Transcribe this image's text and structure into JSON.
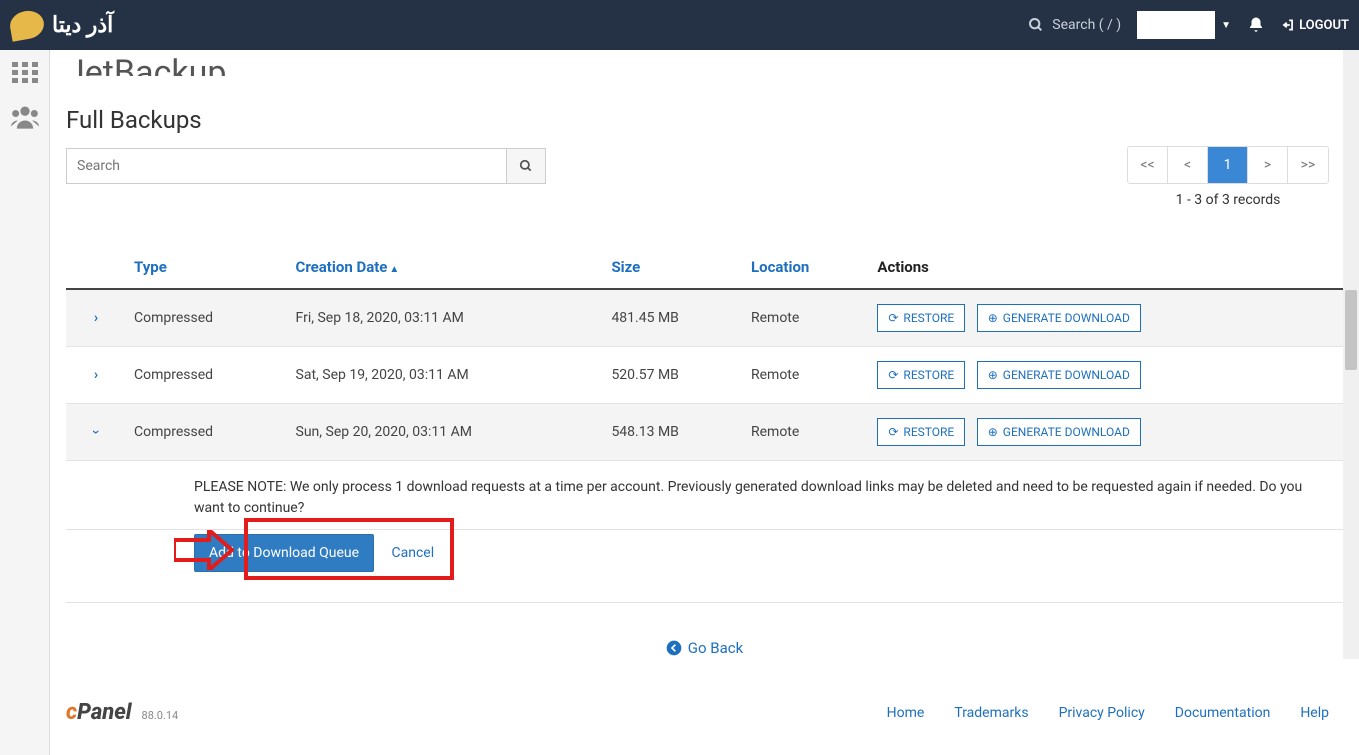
{
  "topbar": {
    "logo_text": "آذر دیتا",
    "search_label": "Search ( / )",
    "logout": "LOGOUT"
  },
  "page": {
    "app_title": "JetBackup",
    "section_title": "Full Backups",
    "search_placeholder": "Search"
  },
  "pager": {
    "first": "<<",
    "prev": "<",
    "current": "1",
    "next": ">",
    "last": ">>",
    "info": "1 - 3 of 3 records"
  },
  "columns": {
    "type": "Type",
    "creation": "Creation Date",
    "size": "Size",
    "location": "Location",
    "actions": "Actions"
  },
  "action_labels": {
    "restore": "RESTORE",
    "download": "GENERATE DOWNLOAD"
  },
  "rows": [
    {
      "type": "Compressed",
      "date": "Fri, Sep 18, 2020, 03:11 AM",
      "size": "481.45 MB",
      "location": "Remote"
    },
    {
      "type": "Compressed",
      "date": "Sat, Sep 19, 2020, 03:11 AM",
      "size": "520.57 MB",
      "location": "Remote"
    },
    {
      "type": "Compressed",
      "date": "Sun, Sep 20, 2020, 03:11 AM",
      "size": "548.13 MB",
      "location": "Remote"
    }
  ],
  "note": "PLEASE NOTE: We only process 1 download requests at a time per account. Previously generated download links may be deleted and need to be requested again if needed. Do you want to continue?",
  "confirm": {
    "add": "Add to Download Queue",
    "cancel": "Cancel"
  },
  "goback": "Go Back",
  "footer": {
    "brand_c": "c",
    "brand_panel": "Panel",
    "version": "88.0.14",
    "links": [
      "Home",
      "Trademarks",
      "Privacy Policy",
      "Documentation",
      "Help"
    ]
  }
}
